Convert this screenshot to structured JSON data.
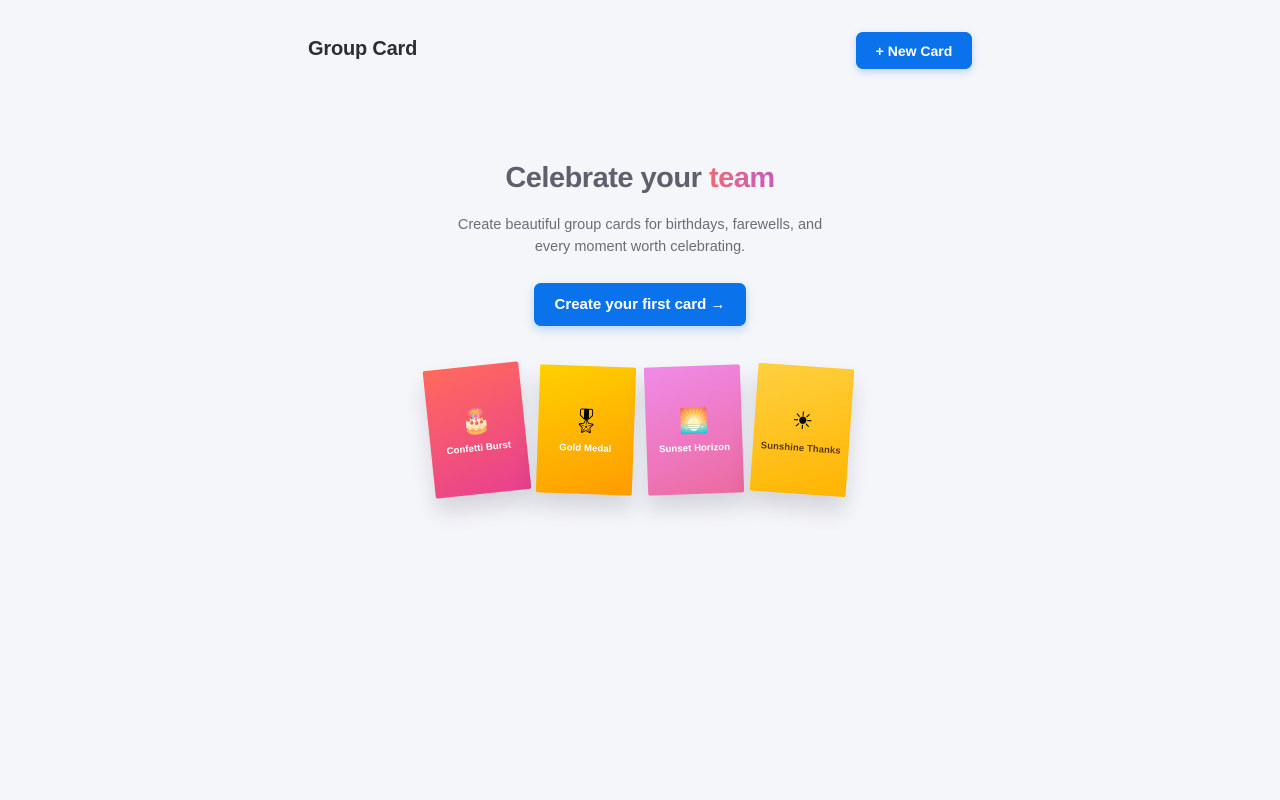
{
  "header": {
    "brand": "Group Card",
    "new_card_label": "+ New Card"
  },
  "hero": {
    "title_prefix": "Celebrate your ",
    "title_accent": "team",
    "subtitle": "Create beautiful group cards for birthdays, farewells, and every moment worth celebrating.",
    "cta_label": "Create your first card →"
  },
  "templates": [
    {
      "name": "Confetti Burst",
      "emoji": "🎂"
    },
    {
      "name": "Gold Medal",
      "emoji": "🎖"
    },
    {
      "name": "Sunset Horizon",
      "emoji": "🌅"
    },
    {
      "name": "Sunshine Thanks",
      "emoji": "☀"
    }
  ],
  "colors": {
    "primary": "#0a72ea",
    "background": "#f5f6fa",
    "accent_gradient_start": "#f06a73",
    "accent_gradient_end": "#c65bbf"
  }
}
